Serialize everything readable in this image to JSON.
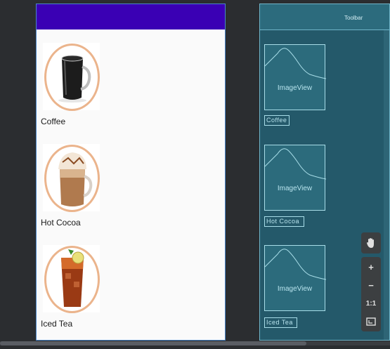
{
  "design": {
    "items": [
      {
        "label": "Coffee",
        "image_icon": "coffee-mug-image"
      },
      {
        "label": "Hot Cocoa",
        "image_icon": "hot-cocoa-image"
      },
      {
        "label": "Iced Tea",
        "image_icon": "iced-tea-image"
      }
    ]
  },
  "blueprint": {
    "toolbar_label": "Toolbar",
    "items": [
      {
        "image_label": "ImageView",
        "text_label": "Coffee"
      },
      {
        "image_label": "ImageView",
        "text_label": "Hot Cocoa"
      },
      {
        "image_label": "ImageView",
        "text_label": "Iced Tea"
      }
    ]
  },
  "zoom_controls": {
    "pan_icon": "hand-icon",
    "zoom_in": "+",
    "zoom_out": "−",
    "actual_size": "1:1",
    "fit_icon": "fit-screen-icon"
  },
  "colors": {
    "toolbar": "#3a00b4",
    "ring": "#ebb48c",
    "blueprint_bg": "#24596a",
    "blueprint_line": "#a8dde8"
  }
}
